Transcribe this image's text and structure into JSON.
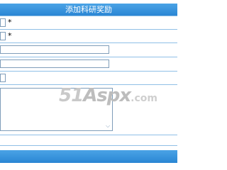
{
  "header": {
    "title": "添加科研奖励"
  },
  "form": {
    "field1": {
      "value": "",
      "required_mark": "*"
    },
    "field2": {
      "value": "",
      "required_mark": "*"
    },
    "field3": {
      "value": ""
    },
    "field4": {
      "value": ""
    },
    "field5": {
      "value": ""
    },
    "textarea": {
      "value": ""
    }
  },
  "watermark": {
    "part1": "51",
    "part2": "Aspx",
    "part3": ".com"
  },
  "colors": {
    "header_bg": "#2a86d4",
    "row_separator": "#8fbfe6",
    "input_border": "#7f9db9"
  }
}
